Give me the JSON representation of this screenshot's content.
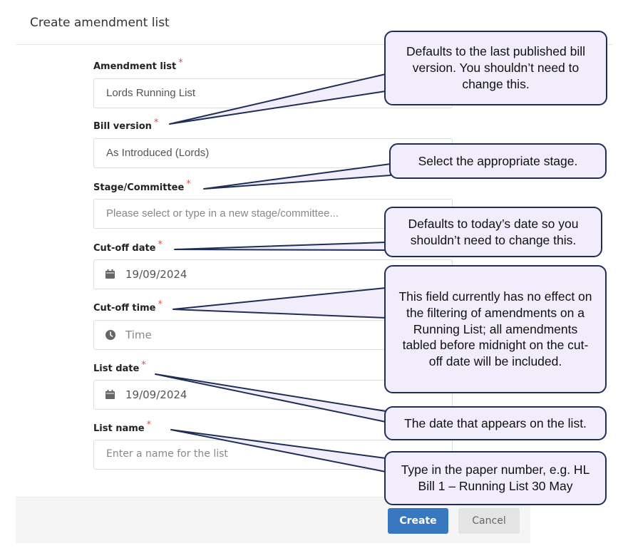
{
  "modal": {
    "title": "Create amendment list"
  },
  "form": {
    "required_marker": "*",
    "amendment_list": {
      "label": "Amendment list",
      "value": "Lords Running List"
    },
    "bill_version": {
      "label": "Bill version",
      "value": "As Introduced (Lords)"
    },
    "stage_committee": {
      "label": "Stage/Committee",
      "placeholder": "Please select or type in a new stage/committee..."
    },
    "cutoff_date": {
      "label": "Cut-off date",
      "value": "19/09/2024",
      "icon": "calendar-icon"
    },
    "cutoff_time": {
      "label": "Cut-off time",
      "placeholder": "Time",
      "icon": "clock-icon"
    },
    "list_date": {
      "label": "List date",
      "value": "19/09/2024",
      "icon": "calendar-icon"
    },
    "list_name": {
      "label": "List name",
      "placeholder": "Enter a name for the list"
    }
  },
  "footer": {
    "create_label": "Create",
    "cancel_label": "Cancel"
  },
  "callouts": {
    "bill_version": "Defaults to the last published bill version. You shouldn’t need to change this.",
    "stage": "Select the appropriate stage.",
    "cutoff_date": "Defaults to today’s date so you shouldn’t need to change this.",
    "cutoff_time": "This field currently has no effect on the filtering of amendments on a Running List; all amendments tabled before midnight on the cut-off date will be included.",
    "list_date": "The date that appears on the list.",
    "list_name": "Type in the paper number, e.g. HL Bill 1 – Running List 30 May"
  },
  "colors": {
    "primary": "#3878c0",
    "required": "#d9534f",
    "callout_fill": "#f1edfb",
    "callout_border": "#1f2e57"
  }
}
